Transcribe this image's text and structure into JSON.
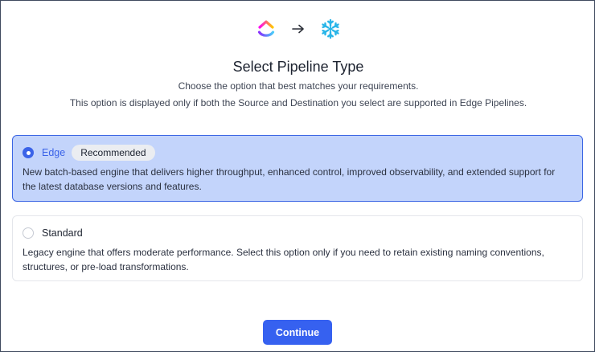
{
  "header": {
    "source_logo_icon": "clickup-logo-icon",
    "arrow_icon": "arrow-right-icon",
    "destination_logo_icon": "snowflake-logo-icon",
    "title": "Select Pipeline Type",
    "subtitle_line1": "Choose the option that best matches your requirements.",
    "subtitle_line2": "This option is displayed only if both the Source and Destination you select are supported in Edge Pipelines."
  },
  "options": [
    {
      "label": "Edge",
      "badge": "Recommended",
      "selected": true,
      "description": "New batch-based engine that delivers higher throughput, enhanced control, improved observability, and extended support for the latest database versions and features."
    },
    {
      "label": "Standard",
      "selected": false,
      "description": "Legacy engine that offers moderate performance. Select this option only if you need to retain existing naming conventions, structures, or pre-load transformations."
    }
  ],
  "footer": {
    "continue_label": "Continue"
  },
  "colors": {
    "accent": "#3661f0",
    "selected_bg": "#c3d4fb",
    "selected_border": "#3c66e4",
    "snowflake": "#29b5e8"
  }
}
